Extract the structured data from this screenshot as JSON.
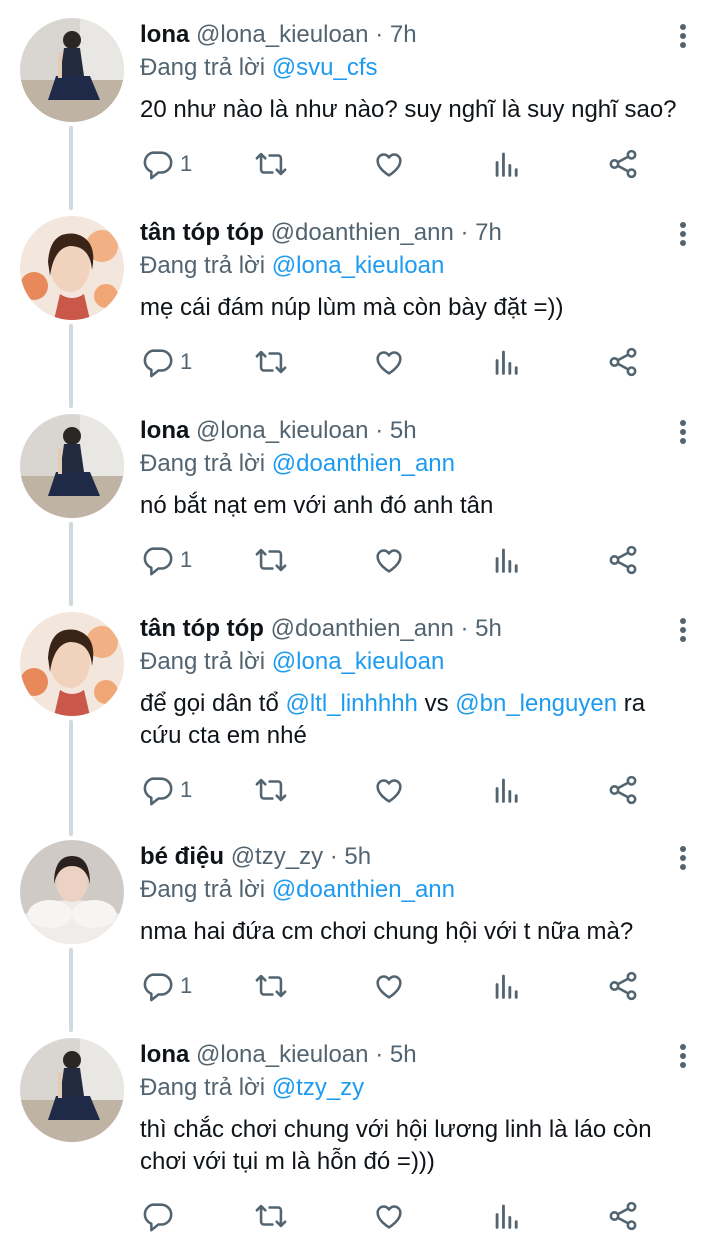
{
  "colors": {
    "link": "#1d9bf0",
    "secondary": "#536471",
    "thread": "#cfd9de"
  },
  "tweets": [
    {
      "name": "lona",
      "handle": "@lona_kieuloan",
      "time": "7h",
      "reply_prefix": "Đang trả lời",
      "reply_to": "@svu_cfs",
      "text": "20 như nào là như nào? suy nghĩ là suy nghĩ sao?",
      "reply_count": "1",
      "avatar": "lona"
    },
    {
      "name": "tân tóp tóp",
      "handle": "@doanthien_ann",
      "time": "7h",
      "reply_prefix": "Đang trả lời",
      "reply_to": "@lona_kieuloan",
      "text": "mẹ cái đám núp lùm mà còn bày đặt =))",
      "reply_count": "1",
      "avatar": "tan"
    },
    {
      "name": "lona",
      "handle": "@lona_kieuloan",
      "time": "5h",
      "reply_prefix": "Đang trả lời",
      "reply_to": "@doanthien_ann",
      "text": "nó bắt nạt em với anh đó anh tân",
      "reply_count": "1",
      "avatar": "lona"
    },
    {
      "name": "tân tóp tóp",
      "handle": "@doanthien_ann",
      "time": "5h",
      "reply_prefix": "Đang trả lời",
      "reply_to": "@lona_kieuloan",
      "text_parts": [
        "để gọi dân tổ ",
        "@ltl_linhhhh",
        " vs ",
        "@bn_lenguyen",
        " ra",
        "cứu cta em nhé"
      ],
      "reply_count": "1",
      "avatar": "tan"
    },
    {
      "name": "bé điệu",
      "handle": "@tzy_zy",
      "time": "5h",
      "reply_prefix": "Đang trả lời",
      "reply_to": "@doanthien_ann",
      "text": "nma hai đứa cm chơi chung hội với t nữa mà?",
      "reply_count": "1",
      "avatar": "dieu"
    },
    {
      "name": "lona",
      "handle": "@lona_kieuloan",
      "time": "5h",
      "reply_prefix": "Đang trả lời",
      "reply_to": "@tzy_zy",
      "text_lines": [
        "thì chắc chơi chung với hội lương linh là láo còn",
        "chơi với tụi m là hỗn đó =)))"
      ],
      "reply_count": "",
      "avatar": "lona"
    }
  ],
  "icons": {
    "reply": "reply-icon",
    "retweet": "retweet-icon",
    "like": "like-icon",
    "views": "views-icon",
    "share": "share-icon",
    "more": "more-icon"
  }
}
